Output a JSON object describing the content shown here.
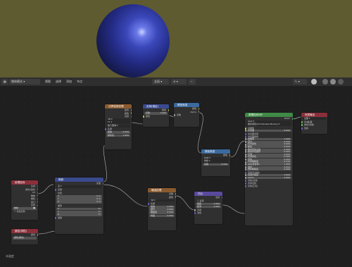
{
  "header": {
    "mode": "物体模式",
    "menus": [
      "视图",
      "选择",
      "添加",
      "节点"
    ],
    "slot": "全局"
  },
  "nodes": {
    "texcoord": {
      "title": "纹理坐标",
      "rows": [
        "生成",
        "法向(法线)",
        "UV",
        "物体",
        "相机",
        "窗口",
        "反射"
      ],
      "object_label": "物体",
      "from_instancer": "来自实例"
    },
    "attr": {
      "title": "属性(特性)",
      "name": "颜色(属性)"
    },
    "mapping": {
      "title": "映射",
      "out": "矢量",
      "type": "点",
      "rows": [
        "矢量",
        "位置",
        "旋转",
        "缩放"
      ],
      "xyz": [
        "X",
        "Y",
        "Z"
      ],
      "loc": [
        "0 m",
        "0 m",
        "0 m"
      ],
      "rot": [
        "0°",
        "0°",
        "0°"
      ],
      "scale": [
        "1.000",
        "1.000",
        "1.000"
      ]
    },
    "voronoi": {
      "title": "沃罗诺伊纹理",
      "outs": [
        "距离",
        "颜色",
        "位置"
      ],
      "dim": "3D",
      "metric": "F1",
      "dist": "欧几里得",
      "vec": "矢量",
      "scale_label": "缩放",
      "scale_val": "5.000",
      "rand_label": "随机性",
      "rand_val": "1.000"
    },
    "invert": {
      "title": "反转(相反)",
      "outs": [
        "颜色"
      ],
      "ins": [
        "系数",
        "颜色"
      ]
    },
    "color_ramp": {
      "title": "颜色渐变",
      "outs": [
        "颜色",
        "Alpha"
      ],
      "in": "系数"
    },
    "noise": {
      "title": "噪波纹理",
      "outs": [
        "系数",
        "颜色"
      ],
      "dim": "3D",
      "rows": [
        "矢量",
        "缩放",
        "细节",
        "粗糙度",
        "畸变"
      ],
      "vals": [
        "",
        "2.000",
        "2.000",
        "0.500",
        "0.000"
      ]
    },
    "bump": {
      "title": "凹凸",
      "out": "法线",
      "invert": "反转",
      "rows": [
        "强度",
        "距离",
        "高度",
        "法线"
      ],
      "vals": [
        "1.000",
        "1.000",
        "",
        ""
      ]
    },
    "ramp2": {
      "title": "颜色渐变",
      "rows": [
        "RGB",
        "线性"
      ],
      "fac_label": "系数",
      "fac_val": "0.500"
    },
    "bsdf": {
      "title": "原理化BSDF",
      "out": "BSDF",
      "dist": "GGX",
      "sss_method": "随机游走(Christensen-Burley)",
      "rows": [
        "基础色",
        "次表面",
        "次表面半径",
        "次表面颜色",
        "金属度",
        "高光",
        "高光染色",
        "糙度",
        "各向异性过滤",
        "各向异性旋转",
        "光泽",
        "光泽染色",
        "清漆",
        "清漆粗糙度",
        "IOR(折射率)",
        "透射",
        "透射粗糙度",
        "自发光(发射)",
        "自发光强度",
        "Alpha",
        "法向(法线)",
        "清漆法线",
        "切向(正切)"
      ],
      "vals": [
        "",
        "0.000",
        "",
        "",
        "1.000",
        "0.500",
        "0.000",
        "0.500",
        "0.000",
        "0.000",
        "0.000",
        "0.500",
        "0.000",
        "0.030",
        "1.450",
        "0.000",
        "0.000",
        "",
        "1.000",
        "1.000",
        "",
        "",
        ""
      ]
    },
    "output": {
      "title": "材质输出",
      "target": "全部",
      "rows": [
        "表(曲)面",
        "体积(音量)",
        "置换"
      ]
    }
  },
  "status": "半选定"
}
